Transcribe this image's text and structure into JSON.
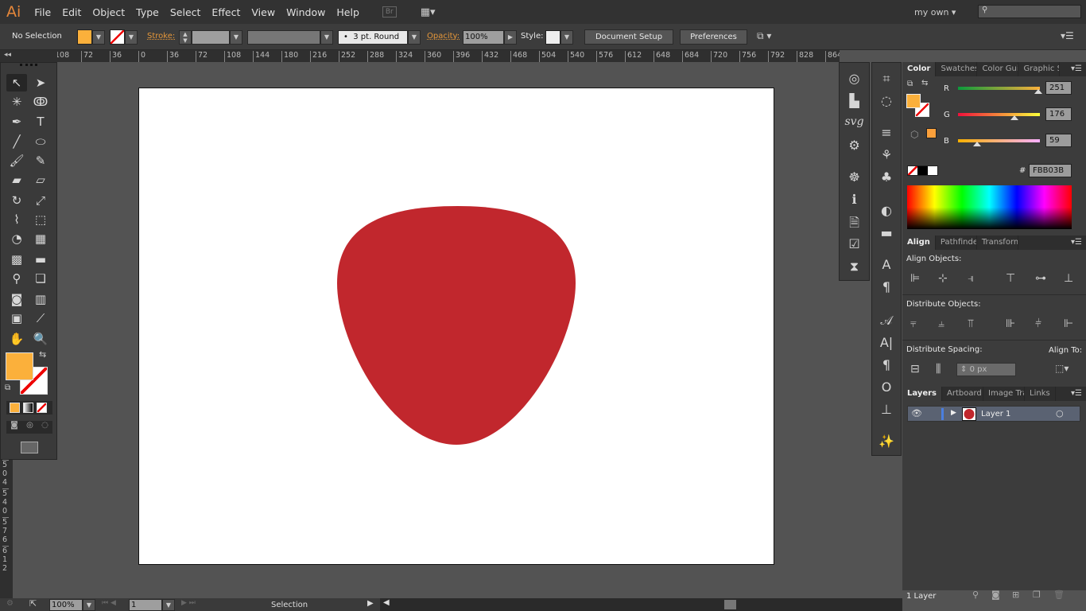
{
  "app": {
    "logo": "Ai",
    "workspace": "my own",
    "bridge": "Br"
  },
  "menu": [
    "File",
    "Edit",
    "Object",
    "Type",
    "Select",
    "Effect",
    "View",
    "Window",
    "Help"
  ],
  "control": {
    "selection": "No Selection",
    "fill_color": "#FBB03B",
    "stroke_label": "Stroke:",
    "brush": "3 pt. Round",
    "opacity_label": "Opacity:",
    "opacity": "100%",
    "style_label": "Style:",
    "document_setup": "Document Setup",
    "preferences": "Preferences"
  },
  "ruler": {
    "h": [
      "108",
      "72",
      "36",
      "0",
      "36",
      "72",
      "108",
      "144",
      "180",
      "216",
      "252",
      "288",
      "324",
      "360",
      "396",
      "432",
      "468",
      "504",
      "540",
      "576",
      "612",
      "648",
      "684",
      "720",
      "756",
      "792",
      "828",
      "864"
    ],
    "v": [
      "504",
      "540",
      "576",
      "612"
    ]
  },
  "tools": [
    {
      "n": "selection-tool",
      "g": "↖"
    },
    {
      "n": "direct-selection-tool",
      "g": "➤"
    },
    {
      "n": "magic-wand-tool",
      "g": "✳"
    },
    {
      "n": "lasso-tool",
      "g": "ↂ"
    },
    {
      "n": "pen-tool",
      "g": "✒"
    },
    {
      "n": "type-tool",
      "g": "T"
    },
    {
      "n": "line-tool",
      "g": "╱"
    },
    {
      "n": "ellipse-tool",
      "g": "⬭"
    },
    {
      "n": "paintbrush-tool",
      "g": "🖌"
    },
    {
      "n": "pencil-tool",
      "g": "✎"
    },
    {
      "n": "blob-brush-tool",
      "g": "▰"
    },
    {
      "n": "eraser-tool",
      "g": "▱"
    },
    {
      "n": "rotate-tool",
      "g": "↻"
    },
    {
      "n": "scale-tool",
      "g": "⤢"
    },
    {
      "n": "width-tool",
      "g": "⌇"
    },
    {
      "n": "free-transform-tool",
      "g": "⬚"
    },
    {
      "n": "shape-builder-tool",
      "g": "◔"
    },
    {
      "n": "perspective-grid-tool",
      "g": "▦"
    },
    {
      "n": "mesh-tool",
      "g": "▩"
    },
    {
      "n": "gradient-tool",
      "g": "▬"
    },
    {
      "n": "eyedropper-tool",
      "g": "⚲"
    },
    {
      "n": "blend-tool",
      "g": "❏"
    },
    {
      "n": "symbol-sprayer-tool",
      "g": "◙"
    },
    {
      "n": "column-graph-tool",
      "g": "▥"
    },
    {
      "n": "artboard-tool",
      "g": "▣"
    },
    {
      "n": "slice-tool",
      "g": "⟋"
    },
    {
      "n": "hand-tool",
      "g": "✋"
    },
    {
      "n": "zoom-tool",
      "g": "🔍"
    }
  ],
  "dock_left": [
    {
      "n": "appearance-icon",
      "g": "◎"
    },
    {
      "n": "graphic-styles-icon",
      "g": "▙"
    },
    {
      "n": "svg-interactivity-icon",
      "g": "svg"
    },
    {
      "n": "actions-icon",
      "g": "⚙"
    },
    {
      "n": "navigator-icon",
      "g": "☸"
    },
    {
      "n": "info-icon",
      "g": "ℹ"
    },
    {
      "n": "document-info-icon",
      "g": "🗎"
    },
    {
      "n": "flattener-preview-icon",
      "g": "☑"
    },
    {
      "n": "separations-preview-icon",
      "g": "⧗"
    }
  ],
  "dock_right": [
    {
      "n": "transparency-icon",
      "g": "⌗"
    },
    {
      "n": "brushes-icon",
      "g": "◌"
    },
    {
      "n": "stroke-icon",
      "g": "≡"
    },
    {
      "n": "brush-library-icon",
      "g": "⚘"
    },
    {
      "n": "symbols-icon",
      "g": "♣"
    },
    {
      "n": "transparency-panel-icon",
      "g": "◐"
    },
    {
      "n": "gradient-panel-icon",
      "g": "▬"
    },
    {
      "n": "character-styles-icon",
      "g": "A"
    },
    {
      "n": "paragraph-styles-icon",
      "g": "¶"
    },
    {
      "n": "glyphs-icon",
      "g": "𝒜"
    },
    {
      "n": "character-icon",
      "g": "A|"
    },
    {
      "n": "paragraph-icon",
      "g": "¶"
    },
    {
      "n": "opentype-icon",
      "g": "O"
    },
    {
      "n": "tabs-icon",
      "g": "⊥"
    },
    {
      "n": "image-trace-icon",
      "g": "✨"
    }
  ],
  "color_panel": {
    "tabs": [
      "Color",
      "Swatches",
      "Color Guide",
      "Graphic Styles"
    ],
    "r_label": "R",
    "g_label": "G",
    "b_label": "B",
    "r": "251",
    "g": "176",
    "b": "59",
    "r_level": 0.984,
    "g_level": 0.69,
    "b_level": 0.231,
    "hex_label": "#",
    "hex": "FBB03B",
    "fill": "#FBB03B"
  },
  "align_panel": {
    "tabs": [
      "Align",
      "Pathfinder",
      "Transform"
    ],
    "align_objects": "Align Objects:",
    "distribute_objects": "Distribute Objects:",
    "distribute_spacing": "Distribute Spacing:",
    "align_to": "Align To:",
    "spacing": "0 px"
  },
  "layers_panel": {
    "tabs": [
      "Layers",
      "Artboard",
      "Image Trace",
      "Links"
    ],
    "layers": [
      {
        "name": "Layer 1",
        "color": "#4a7fe0"
      }
    ],
    "count": "1 Layer"
  },
  "status": {
    "zoom": "100%",
    "artboard": "1",
    "tool": "Selection"
  },
  "artwork": {
    "shape_color": "#C1272D"
  }
}
